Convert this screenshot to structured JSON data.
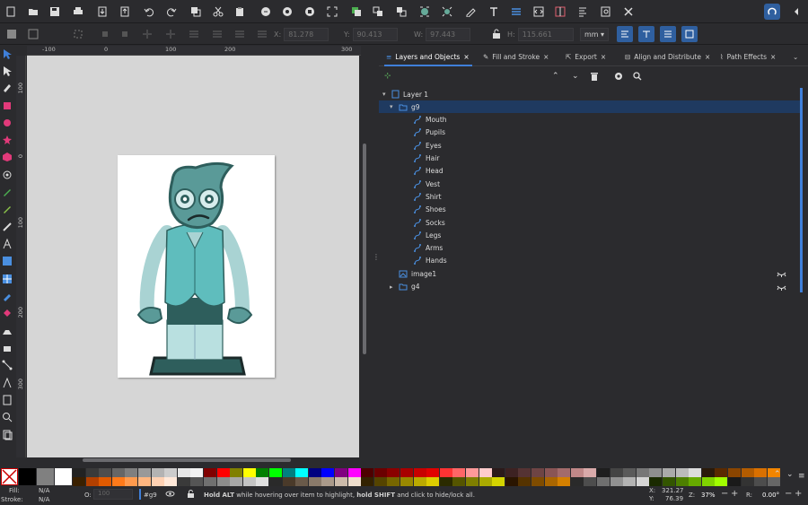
{
  "toolbar_top": {
    "icons": [
      "new-document-icon",
      "open-icon",
      "save-icon",
      "print-icon",
      "import-icon",
      "export-icon",
      "undo-icon",
      "redo-icon",
      "cut-icon",
      "copy-icon",
      "paste-icon",
      "zoom-selection-icon",
      "zoom-drawing-icon",
      "zoom-page-icon",
      "zoom-fit-icon",
      "duplicate-icon",
      "clone-icon",
      "unlink-clone-icon",
      "group-icon",
      "ungroup-icon",
      "fill-stroke-icon",
      "text-icon",
      "layers-icon",
      "xml-editor-icon",
      "align-icon",
      "document-properties-icon",
      "find-icon",
      "preferences-icon",
      "snap-icon",
      "collapse-icon"
    ]
  },
  "toolbar_controls": {
    "x_label": "X:",
    "x_value": "81.278",
    "y_label": "Y:",
    "y_value": "90.413",
    "w_label": "W:",
    "w_value": "97.443",
    "h_label": "H:",
    "h_value": "115.661",
    "unit": "mm"
  },
  "ruler_h_labels": [
    "-100",
    "0",
    "100",
    "200",
    "300"
  ],
  "ruler_v_labels": [
    "100",
    "0",
    "100",
    "200",
    "300"
  ],
  "panel": {
    "tabs": [
      {
        "label": "Layers and Objects",
        "close": "×"
      },
      {
        "label": "Fill and Stroke",
        "close": "×"
      },
      {
        "label": "Export",
        "close": "×"
      },
      {
        "label": "Align and Distribute",
        "close": "×"
      },
      {
        "label": "Path Effects",
        "close": "×"
      }
    ],
    "tree": [
      {
        "label": "Layer 1",
        "kind": "layer",
        "depth": 0,
        "expander": "▾"
      },
      {
        "label": "g9",
        "kind": "group",
        "depth": 1,
        "expander": "▾",
        "selected": true
      },
      {
        "label": "Mouth",
        "kind": "path",
        "depth": 2
      },
      {
        "label": "Pupils",
        "kind": "path",
        "depth": 2
      },
      {
        "label": "Eyes",
        "kind": "path",
        "depth": 2
      },
      {
        "label": "Hair",
        "kind": "path",
        "depth": 2
      },
      {
        "label": "Head",
        "kind": "path",
        "depth": 2
      },
      {
        "label": "Vest",
        "kind": "path",
        "depth": 2
      },
      {
        "label": "Shirt",
        "kind": "path",
        "depth": 2
      },
      {
        "label": "Shoes",
        "kind": "path",
        "depth": 2
      },
      {
        "label": "Socks",
        "kind": "path",
        "depth": 2
      },
      {
        "label": "Legs",
        "kind": "path",
        "depth": 2
      },
      {
        "label": "Arms",
        "kind": "path",
        "depth": 2
      },
      {
        "label": "Hands",
        "kind": "path",
        "depth": 2
      },
      {
        "label": "image1",
        "kind": "image",
        "depth": 1,
        "hidden": true
      },
      {
        "label": "g4",
        "kind": "group",
        "depth": 1,
        "expander": "▸",
        "hidden": true
      }
    ]
  },
  "status": {
    "fill_label": "Fill:",
    "fill_value": "N/A",
    "stroke_label": "Stroke:",
    "stroke_value": "N/A",
    "opacity_label": "O:",
    "opacity_value": "100",
    "object_id": "#g9",
    "hint_bold1": "Hold ALT",
    "hint_mid": " while hovering over item to highlight, ",
    "hint_bold2": "hold SHIFT",
    "hint_end": " and click to hide/lock all.",
    "x_label": "X:",
    "x_value": "321.27",
    "y_label": "Y:",
    "y_value": "76.39",
    "zoom_label": "Z:",
    "zoom_value": "37%",
    "rotation_label": "R:",
    "rotation_value": "0.00°"
  },
  "colors": {
    "accent": "#3f7fd9",
    "selection": "#1f3a60",
    "character_dark": "#2e5e5c",
    "character_mid": "#5fbdbd",
    "character_light": "#a9d3d3"
  }
}
